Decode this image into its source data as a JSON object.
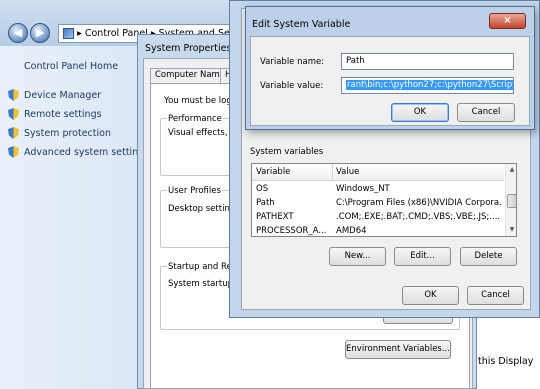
{
  "control_panel": {
    "breadcrumb": [
      "Control Panel",
      "System and Security"
    ],
    "breadcrumb_sep": "▸",
    "back_arrow": "◀",
    "forward_arrow": "▶",
    "home_link": "Control Panel Home",
    "links": [
      "Device Manager",
      "Remote settings",
      "System protection",
      "Advanced system settings"
    ],
    "bottom_text": "this Display"
  },
  "system_properties": {
    "title": "System Properties",
    "tabs": [
      "Computer Name",
      "H"
    ],
    "note": "You must be logge",
    "groups": {
      "performance_title": "Performance",
      "performance_text": "Visual effects, p",
      "user_profiles_title": "User Profiles",
      "user_profiles_text": "Desktop setting",
      "startup_title": "Startup and Rec",
      "startup_text": "System startup,"
    },
    "env_button": "Environment Variables..."
  },
  "environment_variables": {
    "system_vars_label": "System variables",
    "columns": [
      "Variable",
      "Value"
    ],
    "rows": [
      {
        "variable": "OS",
        "value": "Windows_NT"
      },
      {
        "variable": "Path",
        "value": "C:\\Program Files (x86)\\NVIDIA Corpora..."
      },
      {
        "variable": "PATHEXT",
        "value": ".COM;.EXE;.BAT;.CMD;.VBS;.VBE;.JS;...."
      },
      {
        "variable": "PROCESSOR_A...",
        "value": "AMD64"
      }
    ],
    "buttons": {
      "new": "New...",
      "edit": "Edit...",
      "delete": "Delete",
      "ok": "OK",
      "cancel": "Cancel"
    }
  },
  "edit_dialog": {
    "title": "Edit System Variable",
    "close": "×",
    "variable_name_label": "Variable name:",
    "variable_name_value": "Path",
    "variable_value_label": "Variable value:",
    "variable_value_value": "rant\\bin;c:\\python27;c:\\python27\\Scripts",
    "ok": "OK",
    "cancel": "Cancel"
  }
}
